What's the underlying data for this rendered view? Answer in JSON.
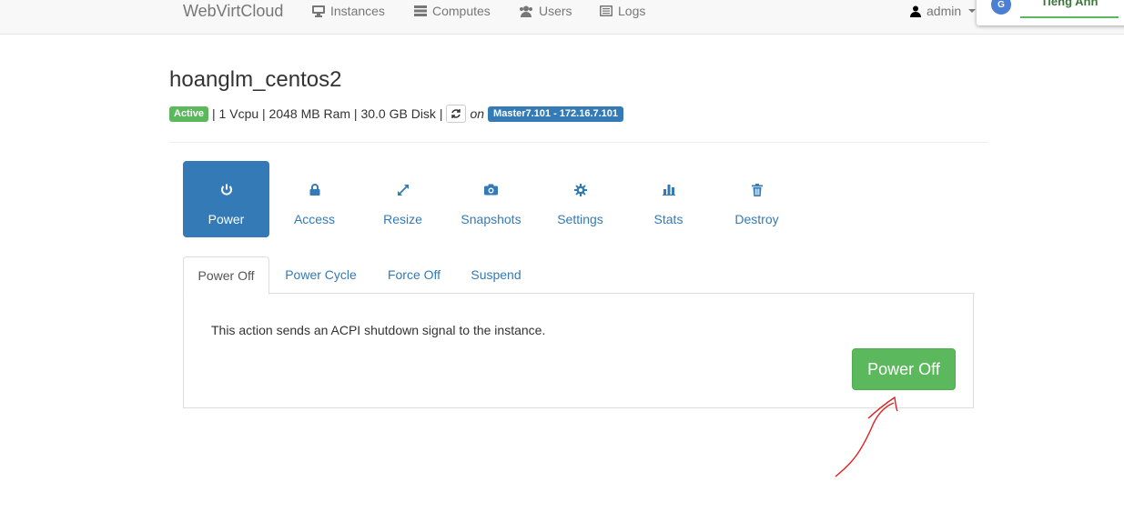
{
  "navbar": {
    "brand": "WebVirtCloud",
    "items": [
      {
        "label": "Instances",
        "icon": "monitor-icon"
      },
      {
        "label": "Computes",
        "icon": "server-icon"
      },
      {
        "label": "Users",
        "icon": "users-icon"
      },
      {
        "label": "Logs",
        "icon": "list-icon"
      }
    ],
    "user": "admin"
  },
  "translate_popup": {
    "logo": "G",
    "tab_label": "Tiếng Anh"
  },
  "instance": {
    "name": "hoanglm_centos2",
    "status": "Active",
    "specs": "| 1 Vcpu | 2048 MB Ram | 30.0 GB Disk |",
    "on_label": "on",
    "host": "Master7.101 - 172.16.7.101"
  },
  "actions": [
    {
      "label": "Power",
      "icon": "power-icon",
      "active": true
    },
    {
      "label": "Access",
      "icon": "lock-icon"
    },
    {
      "label": "Resize",
      "icon": "resize-icon"
    },
    {
      "label": "Snapshots",
      "icon": "camera-icon"
    },
    {
      "label": "Settings",
      "icon": "gear-icon"
    },
    {
      "label": "Stats",
      "icon": "bar-chart-icon"
    },
    {
      "label": "Destroy",
      "icon": "trash-icon"
    }
  ],
  "power_tabs": [
    "Power Off",
    "Power Cycle",
    "Force Off",
    "Suspend"
  ],
  "power_panel": {
    "description": "This action sends an ACPI shutdown signal to the instance.",
    "button_label": "Power Off"
  },
  "colors": {
    "primary": "#337ab7",
    "success": "#5cb85c",
    "annotation": "#e02020"
  }
}
